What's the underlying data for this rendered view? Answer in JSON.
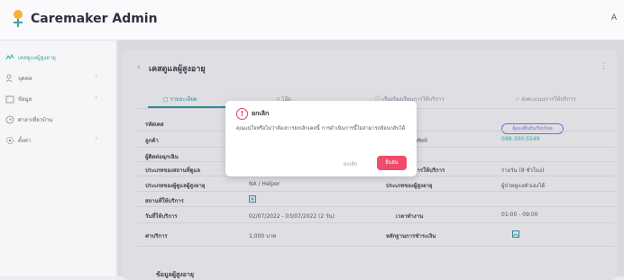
{
  "header": {
    "brand": "Caremaker Admin",
    "avatar_initial": "A"
  },
  "sidebar": {
    "items": [
      {
        "label": "เคสดูแลผู้สูงอายุ",
        "icon": "caregiver-icon"
      },
      {
        "label": "บุคคล",
        "icon": "users-icon"
      },
      {
        "label": "ข้อมูล",
        "icon": "folder-icon"
      },
      {
        "label": "ศาลาเที่ยวบ้าน",
        "icon": "clock-icon"
      },
      {
        "label": "ตั้งค่า",
        "icon": "gear-icon"
      }
    ]
  },
  "page": {
    "title": "เคสดูแลผู้สูงอายุ",
    "tabs": [
      {
        "label": "รายละเอียด",
        "icon": "doc-icon"
      },
      {
        "label": "โอ๊ต",
        "icon": "file-icon"
      },
      {
        "label": "เรื่องร้องเรียนการให้บริการ",
        "icon": "info-icon"
      },
      {
        "label": "ส่งคะแนนการให้บริการ",
        "icon": "star-icon"
      }
    ],
    "status_pill": "ผู้ดูแลยืนยันเรียบร้อย",
    "rows": [
      {
        "label": "รหัสเคส",
        "value": "",
        "label2": "",
        "value2": ""
      },
      {
        "label": "ลูกค้า",
        "value": "",
        "label2": "เบอร์โทรศัพท์",
        "value2": "098-390-5549"
      },
      {
        "label": "ผู้ติดต่อฉุกเฉิน",
        "value": "",
        "label2": "",
        "value2": ""
      },
      {
        "label": "ประเภทของสถานที่ดูแล",
        "value": "",
        "label2": "ประเภทของการให้บริการ",
        "value2": "รายวัน (8 ชั่วโมง)"
      },
      {
        "label": "ประเภทของผู้ดูแลผู้สูงอายุ",
        "value": "NA / Helper",
        "label2": "ประเภทของผู้สูงอายุ",
        "value2": "ผู้ป่วยดูแลตัวเองได้"
      },
      {
        "label": "สถานที่ให้บริการ",
        "value": "",
        "label2": "",
        "value2": ""
      },
      {
        "label": "วันที่ให้บริการ",
        "value": "02/07/2022 - 03/07/2022 (2 วัน)",
        "label2": "เวลาทำงาน",
        "value2": "01:00 - 09:00"
      },
      {
        "label": "ค่าบริการ",
        "value": "1,000 บาท",
        "label2": "หลักฐานการชำระเงิน",
        "value2": ""
      }
    ],
    "section_title": "ข้อมูลผู้สูงอายุ"
  },
  "dialog": {
    "title": "ยกเลิก",
    "body": "คุณแน่ใจหรือไม่ว่าต้องการยกเลิกเคสนี้ การดำเนินการนี้ไม่สามารถย้อนกลับได้",
    "cancel_label": "ยกเลิก",
    "confirm_label": "ยืนยัน"
  },
  "colors": {
    "accent": "#2f8b9b",
    "danger": "#ee4c6a",
    "pill": "#7a6bd0"
  }
}
